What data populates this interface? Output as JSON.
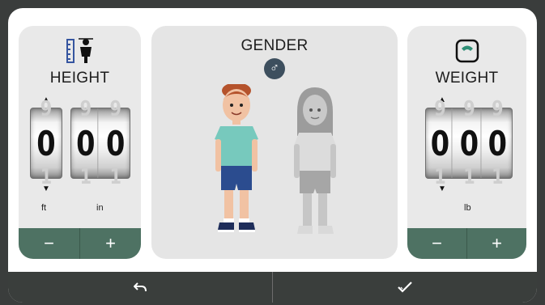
{
  "height": {
    "title": "HEIGHT",
    "icon": "height-measure-icon",
    "feet_digits": [
      "0"
    ],
    "inch_digits": [
      "0",
      "0"
    ],
    "unit_ft": "ft",
    "unit_in": "in",
    "minus_label": "−",
    "plus_label": "+"
  },
  "gender": {
    "title": "GENDER",
    "selected_symbol": "♂",
    "selected": "male",
    "options": [
      "male",
      "female"
    ]
  },
  "weight": {
    "title": "WEIGHT",
    "icon": "scale-icon",
    "digits": [
      "0",
      "0",
      "0"
    ],
    "unit": "lb",
    "minus_label": "−",
    "plus_label": "+"
  },
  "footer": {
    "back_icon": "undo-icon",
    "confirm_icon": "checkmark-icon"
  },
  "colors": {
    "button_green": "#4e7263",
    "footer_dark": "#3a3e3c",
    "scale_accent": "#2f8f76"
  }
}
